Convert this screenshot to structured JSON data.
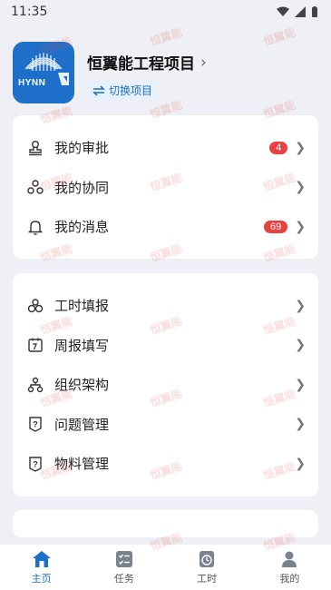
{
  "status_bar": {
    "time": "11:35"
  },
  "header": {
    "logo_text": "HYNN",
    "project_name": "恒翼能工程项目",
    "switch_label": "切换项目"
  },
  "menu1": [
    {
      "label": "我的审批",
      "badge": "4"
    },
    {
      "label": "我的协同",
      "badge": ""
    },
    {
      "label": "我的消息",
      "badge": "69"
    }
  ],
  "menu2": [
    {
      "label": "工时填报"
    },
    {
      "label": "周报填写"
    },
    {
      "label": "组织架构"
    },
    {
      "label": "问题管理"
    },
    {
      "label": "物料管理"
    }
  ],
  "tabbar": [
    {
      "label": "主页",
      "active": true
    },
    {
      "label": "任务",
      "active": false
    },
    {
      "label": "工时",
      "active": false
    },
    {
      "label": "我的",
      "active": false
    }
  ],
  "watermark": "恒翼能",
  "colors": {
    "accent": "#1e6fc9",
    "badge": "#e8413f",
    "background": "#eef0f5"
  }
}
